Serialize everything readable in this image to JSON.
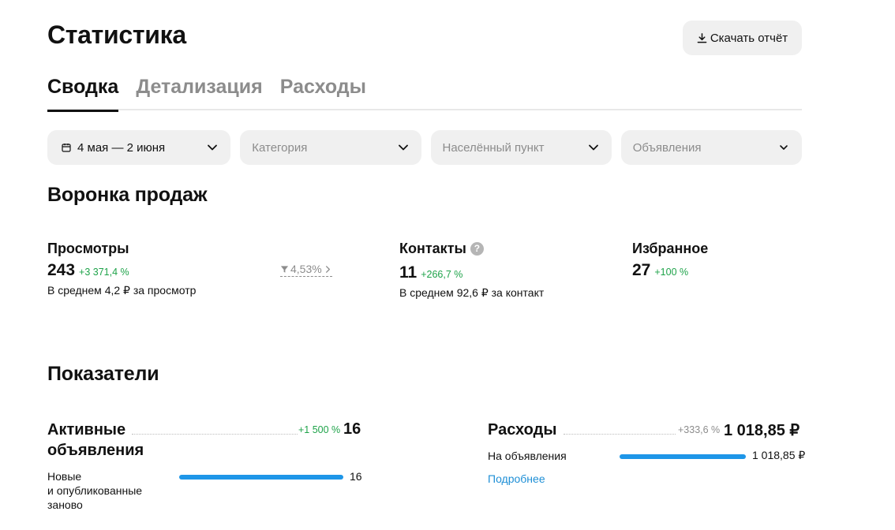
{
  "header": {
    "title": "Статистика",
    "download_label": "Скачать отчёт"
  },
  "tabs": [
    {
      "label": "Сводка",
      "active": true
    },
    {
      "label": "Детализация",
      "active": false
    },
    {
      "label": "Расходы",
      "active": false
    }
  ],
  "filters": {
    "period": "4 мая — 2 июня",
    "category": "Категория",
    "city": "Населённый пункт",
    "ads": "Объявления"
  },
  "funnel": {
    "title": "Воронка продаж",
    "views": {
      "label": "Просмотры",
      "value": "243",
      "delta": "+3 371,4 %",
      "avg": "В среднем 4,2 ₽ за просмотр",
      "conversion": "4,53%"
    },
    "contacts": {
      "label": "Контакты",
      "value": "11",
      "delta": "+266,7 %",
      "avg": "В среднем 92,6 ₽ за контакт"
    },
    "favorites": {
      "label": "Избранное",
      "value": "27",
      "delta": "+100 %"
    }
  },
  "indicators": {
    "title": "Показатели",
    "active_ads": {
      "label_line1": "Активные",
      "label_line2": "объявления",
      "delta": "+1 500 %",
      "value": "16",
      "sub_line1": "Новые",
      "sub_line2": "и опубликованные",
      "sub_line3": "заново",
      "sub_value": "16",
      "sub_fill": 1.0
    },
    "expenses": {
      "label": "Расходы",
      "delta": "+333,6 %",
      "value": "1 018,85 ₽",
      "sub_label": "На объявления",
      "sub_value": "1 018,85 ₽",
      "sub_fill": 1.0,
      "more_link": "Подробнее"
    }
  },
  "colors": {
    "accent_blue": "#1e96e8",
    "positive_green": "#1fa34a",
    "muted_grey": "#8c8c8c",
    "control_bg": "#f0f0f0"
  }
}
